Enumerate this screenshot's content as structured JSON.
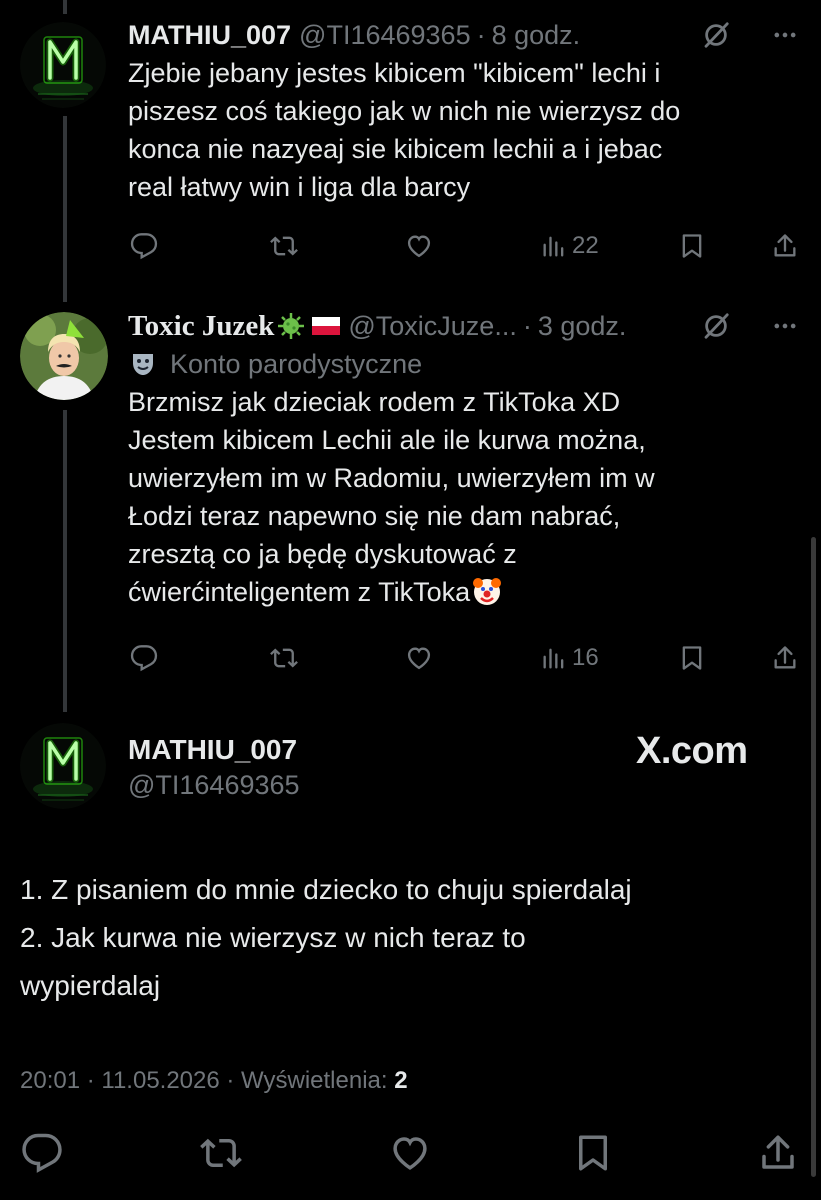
{
  "colors": {
    "background": "#000000",
    "text": "#e7e9ea",
    "muted": "#71767b",
    "neon_green": "#39ff14"
  },
  "tweet1": {
    "name": "MATHIU_007",
    "handle": "@TI16469365",
    "separator": "·",
    "time": "8 godz.",
    "lines": [
      "Zjebie  jebany jestes kibicem \"kibicem\" lechi i",
      "piszesz coś takiego jak w nich nie wierzysz do",
      "konca nie nazyeaj sie kibicem lechii a i jebac",
      "real łatwy win i liga dla barcy"
    ],
    "views": "22"
  },
  "tweet2": {
    "name": "Toxic Juzek",
    "handle": "@ToxicJuze...",
    "separator": "·",
    "time": "3 godz.",
    "parody_label": "Konto parodystyczne",
    "lines": [
      "Brzmisz jak dzieciak rodem z TikToka XD",
      "Jestem kibicem Lechii ale ile kurwa można,",
      "uwierzyłem im w Radomiu, uwierzyłem im w",
      "Łodzi teraz napewno się nie dam nabrać,",
      "zresztą co ja będę dyskutować z",
      "ćwierćinteligentem z TikToka"
    ],
    "views": "16"
  },
  "focus": {
    "name": "MATHIU_007",
    "handle": "@TI16469365",
    "watermark": "X.com",
    "lines": [
      "1. Z pisaniem do mnie dziecko to chuju  spierdalaj",
      "2. Jak kurwa nie wierzysz w nich teraz to",
      "wypierdalaj"
    ],
    "timestamp": "20:01 · 11.05.2026 · Wyświetlenia: ",
    "views_count": "2"
  },
  "icons": {
    "reply": "reply-icon",
    "repost": "repost-icon",
    "like": "heart-icon",
    "views": "views-bar-icon",
    "bookmark": "bookmark-icon",
    "share": "share-icon",
    "grok": "grok-icon",
    "more": "more-icon",
    "virus": "virus-emoji",
    "flag": "poland-flag-emoji",
    "parody": "theater-masks-icon",
    "clown": "clown-emoji"
  }
}
